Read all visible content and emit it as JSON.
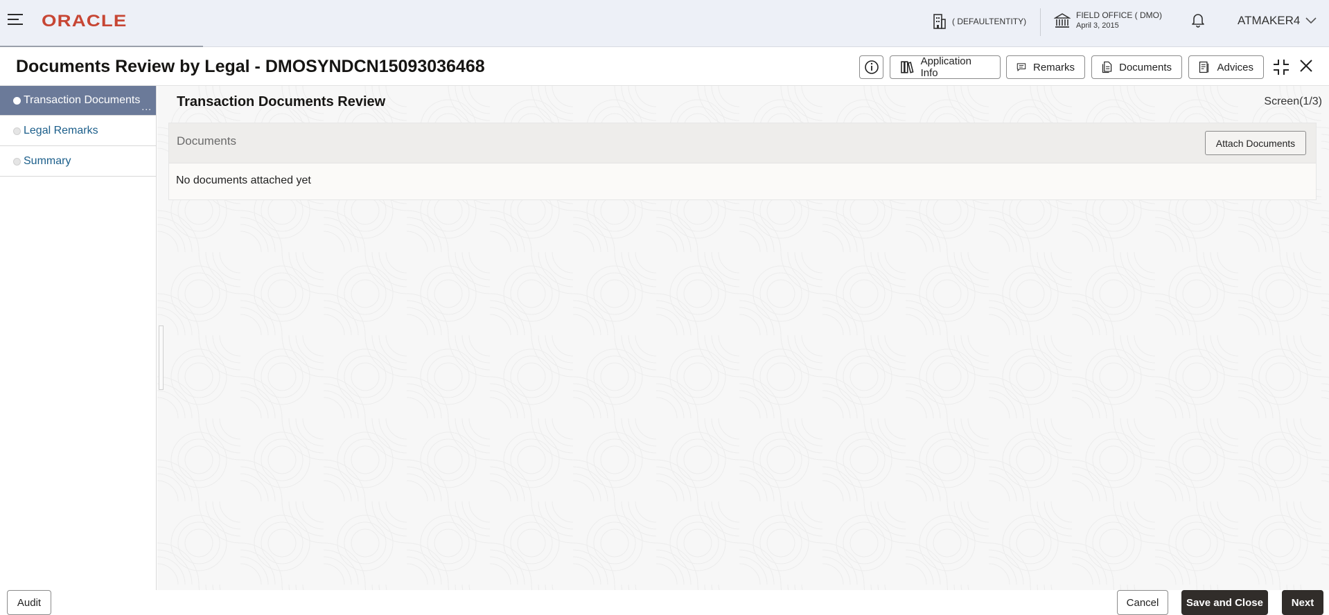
{
  "header": {
    "logo_text": "ORACLE",
    "entity": "( DEFAULTENTITY)",
    "office_name": "FIELD OFFICE ( DMO)",
    "office_date": "April 3, 2015",
    "user": "ATMAKER4"
  },
  "titlebar": {
    "title": "Documents Review by Legal - DMOSYNDCN15093036468",
    "buttons": {
      "application_info": "Application Info",
      "remarks": "Remarks",
      "documents": "Documents",
      "advices": "Advices"
    }
  },
  "nav": {
    "items": [
      {
        "label": "Transaction Documents",
        "active": true
      },
      {
        "label": "Legal Remarks",
        "active": false
      },
      {
        "label": "Summary",
        "active": false
      }
    ],
    "more": "..."
  },
  "main": {
    "section_title": "Transaction Documents Review",
    "screen_count": "Screen(1/3)",
    "documents_panel": {
      "label": "Documents",
      "attach_button": "Attach Documents",
      "empty_text": "No documents attached yet"
    }
  },
  "footer": {
    "audit": "Audit",
    "cancel": "Cancel",
    "save_close": "Save and Close",
    "next": "Next"
  },
  "colors": {
    "brand": "#c74634",
    "nav_active": "#6b7a99",
    "primary_button": "#312d2a",
    "link": "#1b5e8a"
  }
}
